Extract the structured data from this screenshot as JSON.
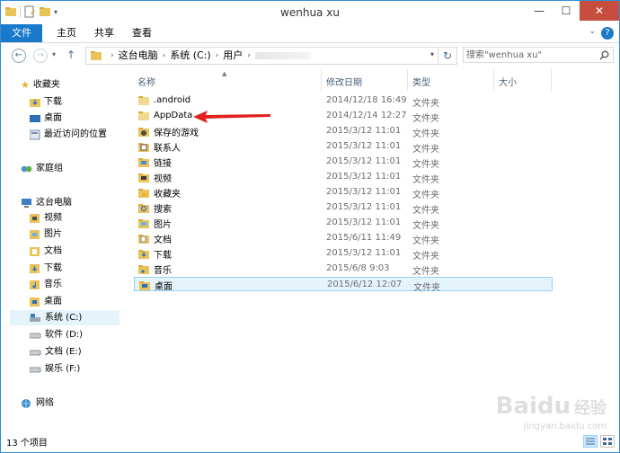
{
  "window": {
    "title": "wenhua xu"
  },
  "ribbon": {
    "tabs": [
      "文件",
      "主页",
      "共享",
      "查看"
    ]
  },
  "nav": {
    "breadcrumb": [
      "这台电脑",
      "系统 (C:)",
      "用户"
    ],
    "search_placeholder": "搜索\"wenhua xu\""
  },
  "sidebar": {
    "favorites": {
      "label": "收藏夹",
      "items": [
        "下载",
        "桌面",
        "最近访问的位置"
      ]
    },
    "homegroup": "家庭组",
    "thispc": {
      "label": "这台电脑",
      "items": [
        "视频",
        "图片",
        "文档",
        "下载",
        "音乐",
        "桌面",
        "系统 (C:)",
        "软件 (D:)",
        "文档 (E:)",
        "娱乐 (F:)"
      ]
    },
    "network": "网络"
  },
  "columns": [
    "名称",
    "修改日期",
    "类型",
    "大小"
  ],
  "files": [
    {
      "name": ".android",
      "date": "2014/12/18 16:49",
      "type": "文件夹"
    },
    {
      "name": "AppData",
      "date": "2014/12/14 12:27",
      "type": "文件夹"
    },
    {
      "name": "保存的游戏",
      "date": "2015/3/12 11:01",
      "type": "文件夹"
    },
    {
      "name": "联系人",
      "date": "2015/3/12 11:01",
      "type": "文件夹"
    },
    {
      "name": "链接",
      "date": "2015/3/12 11:01",
      "type": "文件夹"
    },
    {
      "name": "视频",
      "date": "2015/3/12 11:01",
      "type": "文件夹"
    },
    {
      "name": "收藏夹",
      "date": "2015/3/12 11:01",
      "type": "文件夹"
    },
    {
      "name": "搜索",
      "date": "2015/3/12 11:01",
      "type": "文件夹"
    },
    {
      "name": "图片",
      "date": "2015/3/12 11:01",
      "type": "文件夹"
    },
    {
      "name": "文档",
      "date": "2015/6/11 11:49",
      "type": "文件夹"
    },
    {
      "name": "下载",
      "date": "2015/3/12 11:01",
      "type": "文件夹"
    },
    {
      "name": "音乐",
      "date": "2015/6/8 9:03",
      "type": "文件夹"
    },
    {
      "name": "桌面",
      "date": "2015/6/12 12:07",
      "type": "文件夹"
    }
  ],
  "status": {
    "count": "13 个项目"
  },
  "watermark": {
    "brand": "Baidu",
    "cn": "经验",
    "url": "jingyan.baidu.com"
  },
  "colors": {
    "accent": "#1979ca",
    "selection": "#e5f3fb",
    "close": "#c74d3f"
  }
}
